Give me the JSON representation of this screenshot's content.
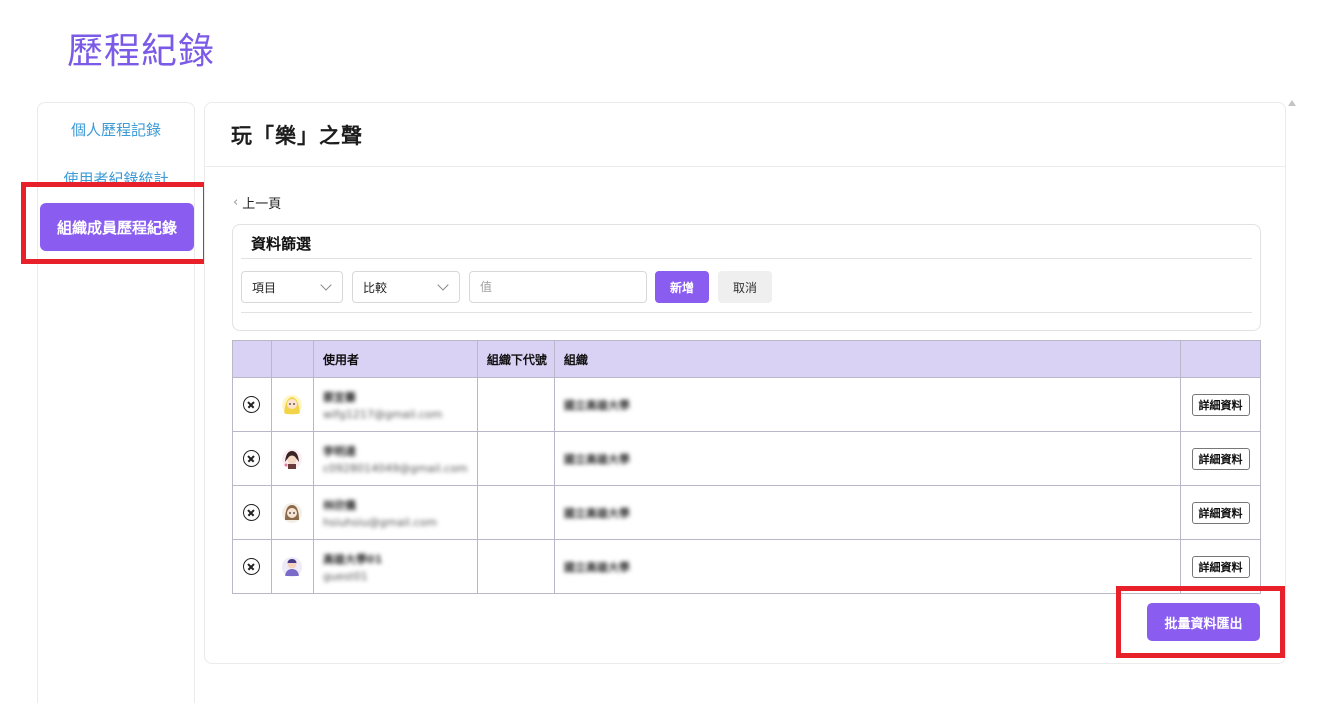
{
  "page": {
    "title": "歷程紀錄"
  },
  "sidebar": {
    "items": [
      {
        "label": "個人歷程記錄"
      },
      {
        "label": "使用者紀錄統計"
      },
      {
        "label": "組織成員歷程紀錄",
        "active": true
      }
    ]
  },
  "main": {
    "title": "玩「樂」之聲",
    "back_label": "上一頁"
  },
  "filter": {
    "title": "資料篩選",
    "field_select": "項目",
    "compare_select": "比較",
    "value_placeholder": "值",
    "add_label": "新增",
    "cancel_label": "取消"
  },
  "table": {
    "headers": {
      "delete": "",
      "avatar": "",
      "user": "使用者",
      "code": "組織下代號",
      "org": "組織",
      "action": ""
    },
    "rows": [
      {
        "name": "蔡宜蓁",
        "email": "wifg1217@gmail.com",
        "code": "",
        "org": "國立高雄大學",
        "action": "詳細資料",
        "avatar": "blonde-girl"
      },
      {
        "name": "李明達",
        "email": "c0928014049@gmail.com",
        "code": "",
        "org": "國立高雄大學",
        "action": "詳細資料",
        "avatar": "dark-hair-figure"
      },
      {
        "name": "林欣儀",
        "email": "hsiuhsiu@gmail.com",
        "code": "",
        "org": "國立高雄大學",
        "action": "詳細資料",
        "avatar": "brown-hair-girl"
      },
      {
        "name": "高雄大學01",
        "email": "guest01",
        "code": "",
        "org": "國立高雄大學",
        "action": "詳細資料",
        "avatar": "purple-person"
      }
    ]
  },
  "export_label": "批量資料匯出",
  "colors": {
    "accent": "#8a5cf0",
    "title": "#7a5ae6",
    "link": "#3d9bd6",
    "highlight": "#e8202a",
    "table_header": "#d9d2f5"
  }
}
